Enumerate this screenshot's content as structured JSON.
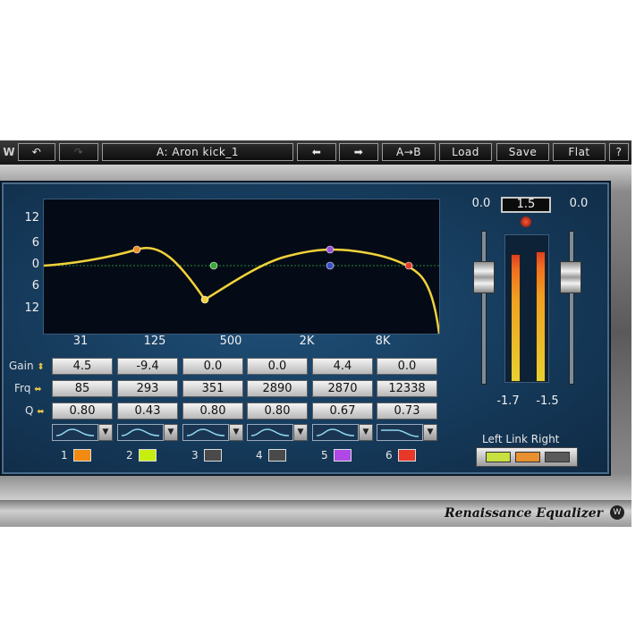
{
  "toolbar": {
    "logo": "W",
    "undo_icon": "↶",
    "redo_icon": "↷",
    "preset_name": "A: Aron kick_1",
    "prev_icon": "⬅",
    "next_icon": "➡",
    "ab_label": "A→B",
    "load_label": "Load",
    "save_label": "Save",
    "flat_label": "Flat",
    "help_label": "?"
  },
  "graph": {
    "y_ticks": [
      "12",
      "6",
      "0",
      "6",
      "12"
    ],
    "x_ticks": [
      "31",
      "125",
      "500",
      "2K",
      "8K"
    ],
    "curve_color": "#f2d23a",
    "markers": [
      {
        "band": 1,
        "color": "#f0902a"
      },
      {
        "band": 2,
        "color": "#f2d23a"
      },
      {
        "band": 3,
        "color": "#3aa83a"
      },
      {
        "band": 4,
        "color": "#3a4ec8"
      },
      {
        "band": 5,
        "color": "#9a52d8"
      },
      {
        "band": 6,
        "color": "#e0402a"
      }
    ]
  },
  "bands": {
    "labels": {
      "gain": "Gain",
      "freq": "Frq",
      "q": "Q",
      "gain_arrows": "⬍",
      "freq_arrows": "⬌",
      "q_arrows": "⬌"
    },
    "gain": [
      "4.5",
      "-9.4",
      "0.0",
      "0.0",
      "4.4",
      "0.0"
    ],
    "freq": [
      "85",
      "293",
      "351",
      "2890",
      "2870",
      "12338"
    ],
    "q": [
      "0.80",
      "0.43",
      "0.80",
      "0.80",
      "0.67",
      "0.73"
    ],
    "dropdown_icon": "▼",
    "numbers": [
      "1",
      "2",
      "3",
      "4",
      "5",
      "6"
    ],
    "colors": [
      "#f08a10",
      "#c6ee10",
      "#4a4a4a",
      "#4a4a4a",
      "#b048e8",
      "#e8382a"
    ]
  },
  "output": {
    "trim": "1.5",
    "left_gain": "0.0",
    "right_gain": "0.0",
    "left_peak": "-1.7",
    "right_peak": "-1.5",
    "left_level": 0.88,
    "right_level": 0.9,
    "link_labels": "Left Link Right",
    "link_colors": [
      "#c8e040",
      "#e89030",
      "#5a5a5a"
    ]
  },
  "footer": {
    "product_name": "Renaissance Equalizer",
    "badge": "W"
  }
}
